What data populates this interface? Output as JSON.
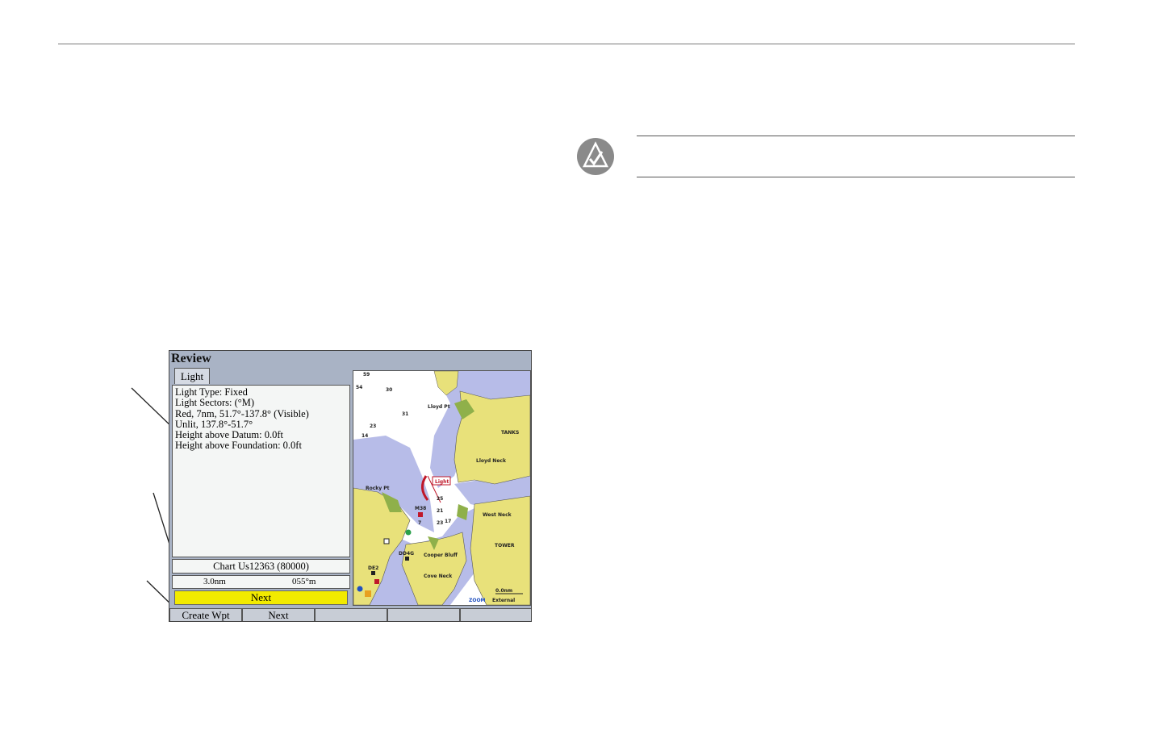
{
  "screen": {
    "title": "Review",
    "tab_label": "Light",
    "info_lines": [
      "Light Type: Fixed",
      "Light Sectors: (°M)",
      "Red, 7nm, 51.7°-137.8° (Visible)",
      "Unlit, 137.8°-51.7°",
      "Height above Datum: 0.0ft",
      "Height above Foundation: 0.0ft"
    ],
    "chart_label": "Chart Us12363 (80000)",
    "distance": "3.0nm",
    "bearing": "055°m",
    "highlight_label": "Next",
    "softkeys": [
      "Create Wpt",
      "Next",
      "",
      "",
      ""
    ]
  },
  "map": {
    "place_labels": [
      "Lloyd Neck",
      "West Neck",
      "Cooper Bluff",
      "Cove Neck",
      "Rocky Pt",
      "Lloyd Pt",
      "TOWER",
      "TANKS"
    ],
    "light_label": "Light",
    "marker_labels": [
      "M38",
      "DD4G",
      "DE2"
    ],
    "depth_labels": [
      "59",
      "54",
      "30",
      "31",
      "23",
      "14",
      "25",
      "21",
      "23",
      "17",
      "7"
    ],
    "scale": "0.0nm",
    "mode": "External",
    "zoom_label": "ZOOM"
  },
  "colors": {
    "land": "#e8e17a",
    "shallow_water": "#b7bce8",
    "deep_water": "#ffffff",
    "marsh": "#8fb04a",
    "highlight": "#f2ea00",
    "screen_frame": "#a9b3c5"
  }
}
